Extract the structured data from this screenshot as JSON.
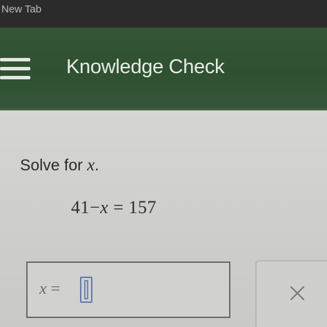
{
  "browser": {
    "tab_title": "New Tab"
  },
  "header": {
    "title": "Knowledge Check",
    "menu_icon": "hamburger-menu-icon"
  },
  "question": {
    "prompt_text": "Solve for ",
    "prompt_var": "x",
    "prompt_end": ".",
    "equation": {
      "left": "41",
      "minus": "−",
      "var": "x",
      "equals": "=",
      "right": "157"
    }
  },
  "answer": {
    "var": "x",
    "equals": "="
  },
  "actions": {
    "clear_icon": "close-icon"
  },
  "colors": {
    "header": "#2f5131",
    "accent": "#5f7bb0",
    "background": "#cfcfcb"
  }
}
